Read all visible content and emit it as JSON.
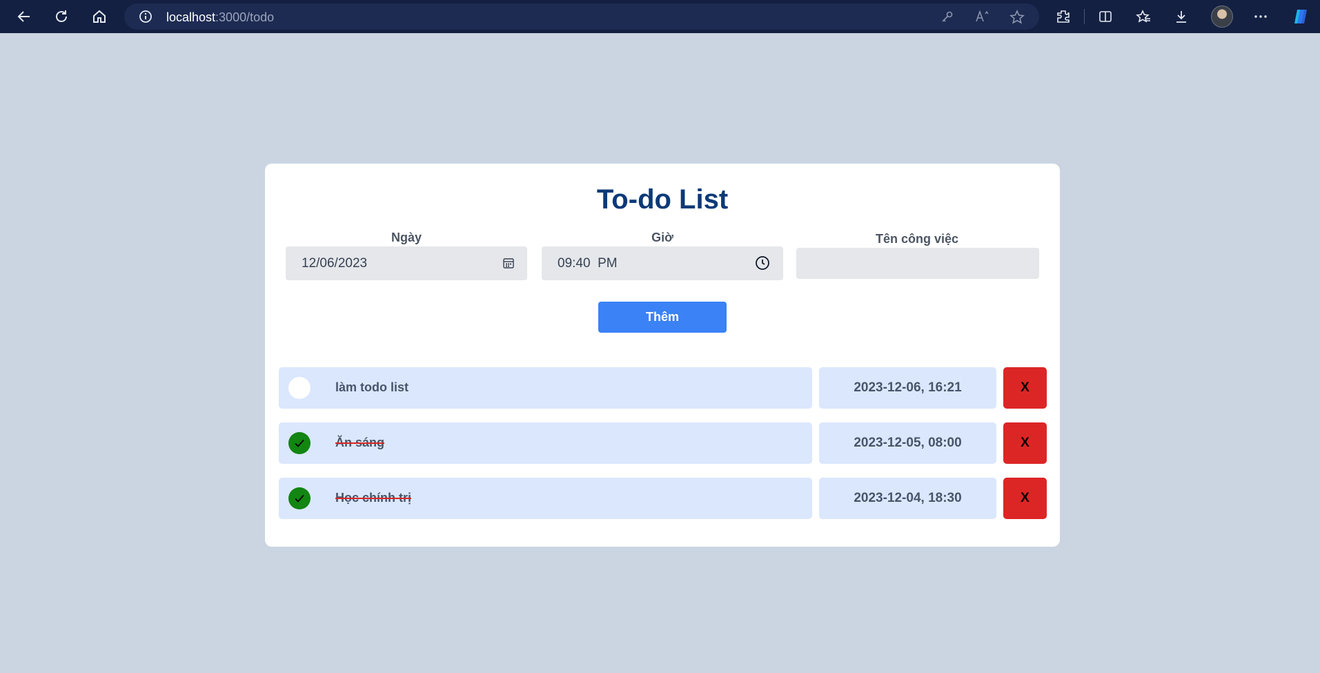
{
  "browser": {
    "url_host": "localhost",
    "url_rest": ":3000/todo"
  },
  "app": {
    "title": "To-do List",
    "date_label": "Ngày",
    "date_value": "12/06/2023",
    "time_label": "Giờ",
    "time_value": "09:40  PM",
    "task_label": "Tên công việc",
    "task_value": "",
    "add_label": "Thêm",
    "delete_label": "X"
  },
  "todos": [
    {
      "text": "làm todo list",
      "datetime": "2023-12-06, 16:21",
      "done": false
    },
    {
      "text": "Ăn sáng",
      "datetime": "2023-12-05, 08:00",
      "done": true
    },
    {
      "text": "Học chính trị",
      "datetime": "2023-12-04, 18:30",
      "done": true
    }
  ]
}
